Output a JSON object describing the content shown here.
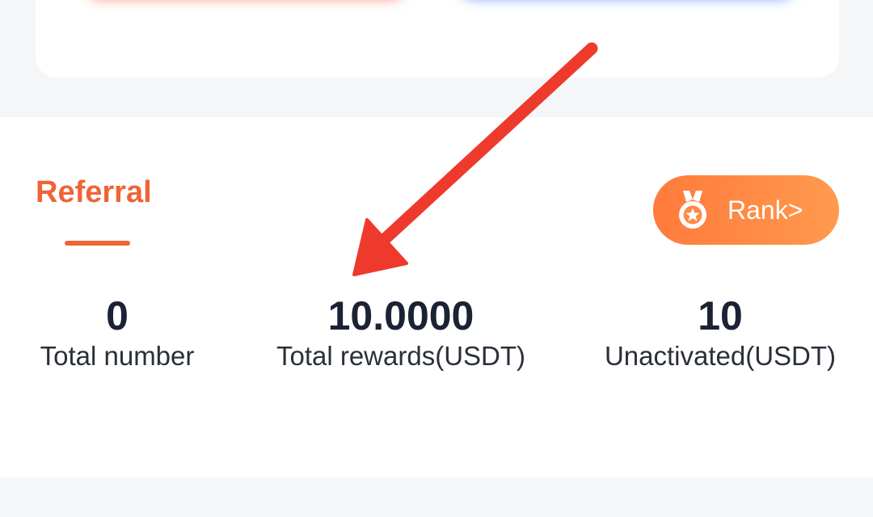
{
  "referral": {
    "tab_label": "Referral",
    "rank_button_label": "Rank>"
  },
  "stats": [
    {
      "value": "0",
      "label": "Total number"
    },
    {
      "value": "10.0000",
      "label": "Total rewards(USDT)"
    },
    {
      "value": "10",
      "label": "Unactivated(USDT)"
    }
  ],
  "icons": {
    "rank": "medal-icon",
    "annotation": "red-arrow-annotation"
  },
  "colors": {
    "accent_orange": "#ef6436",
    "rank_button_gradient_start": "#ff7a3c",
    "rank_button_gradient_end": "#ff9a4d",
    "value_text": "#1b2233",
    "annotation_red": "#ee3a2c"
  }
}
